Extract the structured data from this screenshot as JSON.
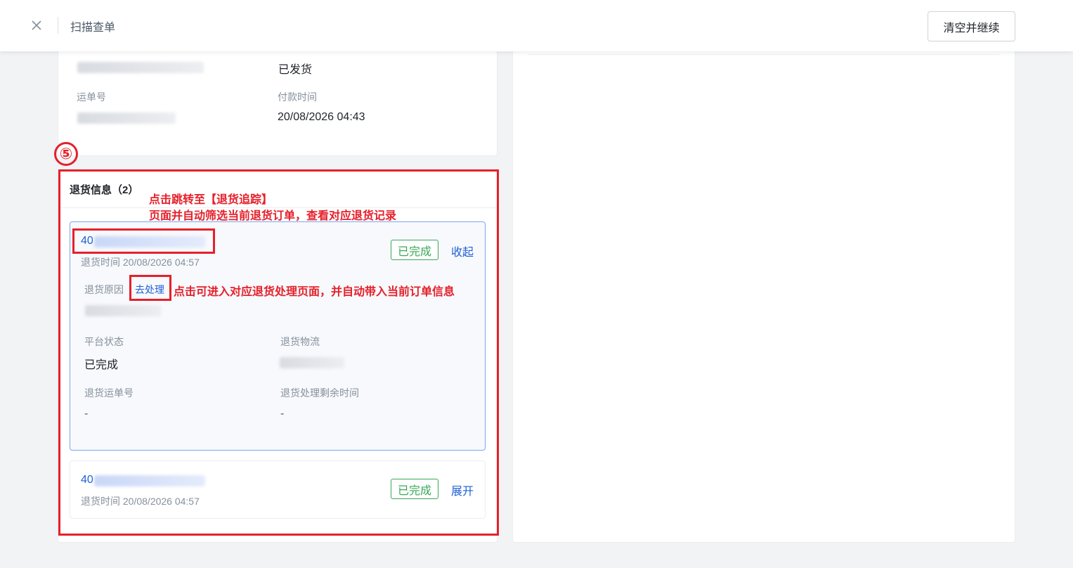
{
  "header": {
    "title": "扫描查单",
    "clear_button": "清空并继续"
  },
  "order_info": {
    "ship_status_value": "已发货",
    "waybill_label": "运单号",
    "pay_time_label": "付款时间",
    "pay_time_value": "20/08/2026 04:43"
  },
  "annotation": {
    "step_number": "⑤",
    "jump_note_line1": "点击跳转至【退货追踪】",
    "jump_note_line2": "页面并自动筛选当前退货订单，查看对应退货记录",
    "process_note": "点击可进入对应退货处理页面，并自动带入当前订单信息",
    "color": "#e5202a"
  },
  "returns": {
    "title": "退货信息（2）",
    "items": [
      {
        "order_prefix": "40",
        "time_label": "退货时间 20/08/2026 04:57",
        "status": "已完成",
        "toggle": "收起",
        "reason_label": "退货原因",
        "process_link": "去处理",
        "platform_status_label": "平台状态",
        "platform_status_value": "已完成",
        "logistics_label": "退货物流",
        "return_waybill_label": "退货运单号",
        "return_waybill_value": "-",
        "remaining_time_label": "退货处理剩余时间",
        "remaining_time_value": "-"
      },
      {
        "order_prefix": "40",
        "time_label": "退货时间 20/08/2026 04:57",
        "status": "已完成",
        "toggle": "展开"
      }
    ]
  },
  "colors": {
    "link": "#1f5fd6",
    "success": "#39a857",
    "expanded_border": "#7aa7f0"
  }
}
